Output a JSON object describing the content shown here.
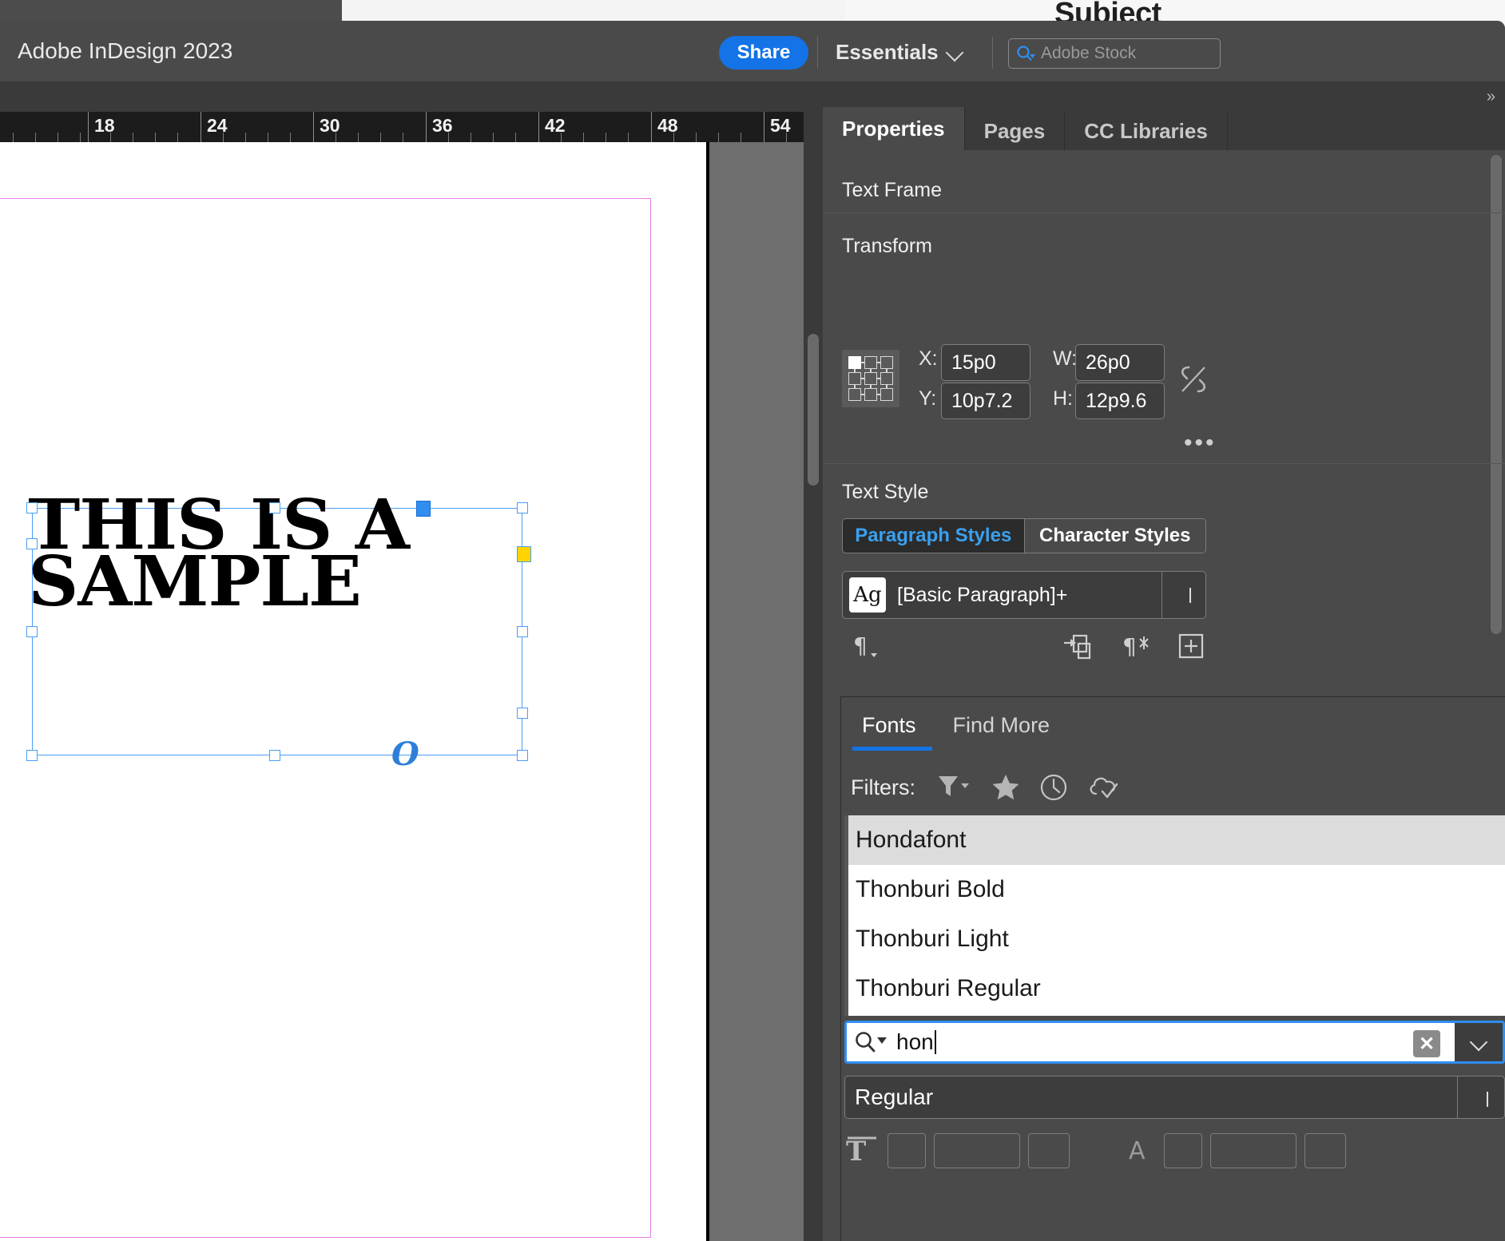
{
  "background": {
    "subject_text": "Subject"
  },
  "header": {
    "app_title": "Adobe InDesign 2023",
    "share_label": "Share",
    "workspace_label": "Essentials",
    "stock_placeholder": "Adobe Stock",
    "search_icon": "search-icon",
    "chevron_icon": "chevron-down-icon"
  },
  "ruler": {
    "unit": "picas",
    "labels": [
      "18",
      "24",
      "30",
      "36",
      "42",
      "48",
      "54"
    ]
  },
  "canvas": {
    "frame_text_line1": "THIS IS A",
    "frame_text_line2": "SAMPLE",
    "overset_marker": "O"
  },
  "dock": {
    "collapse_icon": "double-chevron-right-icon",
    "tabs": [
      {
        "label": "Properties",
        "active": true
      },
      {
        "label": "Pages",
        "active": false
      },
      {
        "label": "CC Libraries",
        "active": false
      }
    ]
  },
  "properties": {
    "object_type": "Text Frame",
    "transform": {
      "title": "Transform",
      "x_label": "X:",
      "x_value": "15p0",
      "y_label": "Y:",
      "y_value": "10p7.2",
      "w_label": "W:",
      "w_value": "26p0",
      "h_label": "H:",
      "h_value": "12p9.6",
      "reference_point": "top-left",
      "link_icon": "chain-broken-icon",
      "more_options": "…"
    },
    "text_style": {
      "title": "Text Style",
      "paragraph_styles_label": "Paragraph Styles",
      "character_styles_label": "Character Styles",
      "active_tab": "Paragraph Styles",
      "style_swatch": "Ag",
      "style_name": "[Basic Paragraph]+",
      "dropdown_icon": "chevron-down-icon",
      "action_icons": [
        "pilcrow-options-icon",
        "load-styles-icon",
        "clear-overrides-icon",
        "new-style-icon"
      ]
    }
  },
  "fonts_panel": {
    "tabs": [
      {
        "label": "Fonts",
        "active": true
      },
      {
        "label": "Find More",
        "active": false
      }
    ],
    "filters_label": "Filters:",
    "filter_icons": [
      "funnel-filter-icon",
      "star-favorites-icon",
      "clock-recent-icon",
      "cloud-activated-icon"
    ],
    "font_list": [
      {
        "name": "Hondafont",
        "selected": true
      },
      {
        "name": "Thonburi Bold",
        "selected": false
      },
      {
        "name": "Thonburi Light",
        "selected": false
      },
      {
        "name": "Thonburi Regular",
        "selected": false
      }
    ],
    "search": {
      "value": "hon",
      "icon": "search-icon",
      "clear_icon": "clear-x-icon",
      "dropdown_icon": "chevron-down-icon"
    },
    "font_style": {
      "value": "Regular",
      "dropdown_icon": "chevron-down-icon"
    }
  },
  "colors": {
    "accent_blue": "#1473e6",
    "link_blue": "#3aa0ef",
    "selection_blue": "#4a9ef5",
    "outport_yellow": "#ffd400",
    "margin_magenta": "#e87fe8",
    "panel_bg": "#4a4a4a",
    "dock_bg": "#3a3a3a"
  }
}
